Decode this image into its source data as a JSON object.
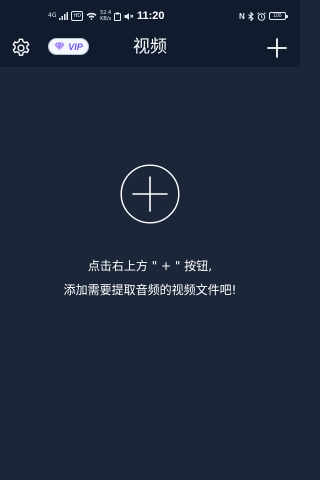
{
  "status_bar": {
    "network": "4G",
    "hd": "HD",
    "speed_value": "52.4",
    "speed_unit": "KB/s",
    "time": "11:20",
    "nfc": "N",
    "battery": "100"
  },
  "header": {
    "vip_label": "VIP",
    "title": "视频"
  },
  "empty_state": {
    "line1": "点击右上方 \" + \" 按钮,",
    "line2": "添加需要提取音频的视频文件吧!"
  },
  "colors": {
    "background": "#1b2639",
    "bar_background": "#101b2e",
    "vip_accent": "#6a55e8"
  },
  "icons": {
    "settings": "gear-icon",
    "add": "plus-icon",
    "vip": "diamond-icon"
  }
}
